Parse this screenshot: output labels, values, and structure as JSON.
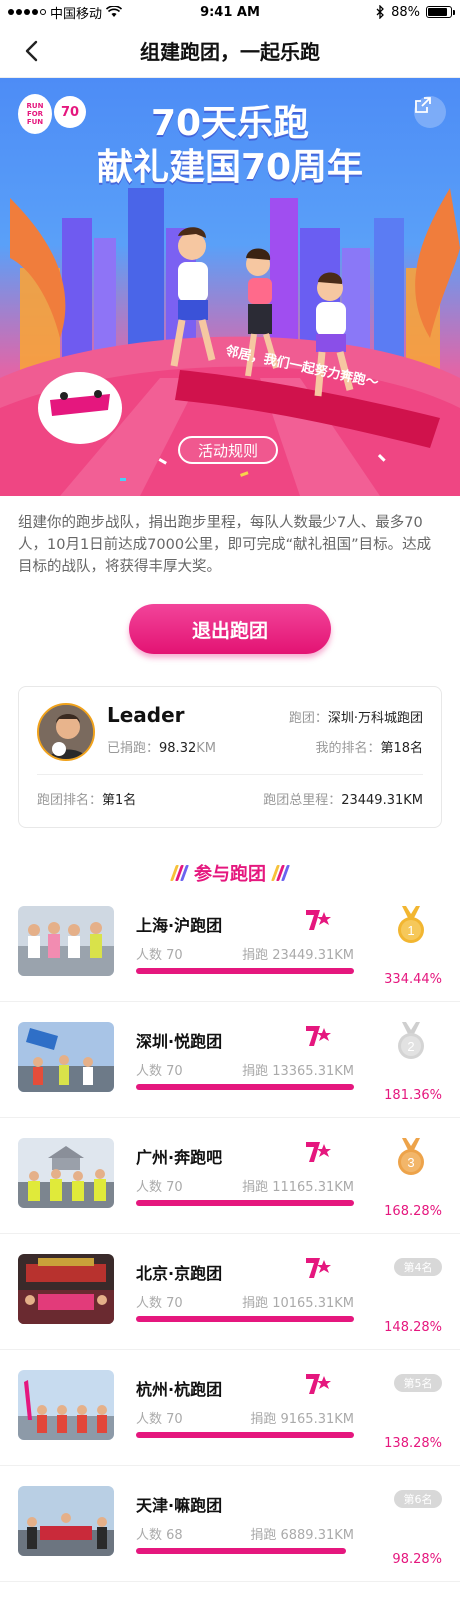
{
  "status_bar": {
    "carrier": "中国移动",
    "time": "9:41 AM",
    "battery": "88%"
  },
  "nav": {
    "title": "组建跑团，一起乐跑"
  },
  "banner": {
    "logo_run": [
      "RUN",
      "FOR",
      "FUN"
    ],
    "logo_70": "70",
    "title_line1": "70天乐跑",
    "title_line2": "献礼建国70周年",
    "ribbon": "邻居，我们一起努力奔跑～",
    "rules_button": "活动规则"
  },
  "description": "组建你的跑步战队，捐出跑步里程，每队人数最少7人、最多70人，10月1日前达成7000公里，即可完成“献礼祖国”目标。达成目标的战队，将获得丰厚大奖。",
  "quit_button": "退出跑团",
  "leader_card": {
    "name": "Leader",
    "team_label": "跑团：",
    "team_value": "深圳·万科城跑团",
    "donated_label": "已捐跑：",
    "donated_value": "98.32",
    "donated_unit": "KM",
    "my_rank_label": "我的排名：",
    "my_rank_value": "第18名",
    "team_rank_label": "跑团排名：",
    "team_rank_value": "第1名",
    "team_total_label": "跑团总里程：",
    "team_total_value": "23449.31KM"
  },
  "section_title": "参与跑团",
  "teams": [
    {
      "name": "上海·沪跑团",
      "members": "人数 70",
      "donated": "捐跑 23449.31KM",
      "percent": "334.44%",
      "rank": "1",
      "medal": "gold"
    },
    {
      "name": "深圳·悦跑团",
      "members": "人数 70",
      "donated": "捐跑 13365.31KM",
      "percent": "181.36%",
      "rank": "2",
      "medal": "silver"
    },
    {
      "name": "广州·奔跑吧",
      "members": "人数 70",
      "donated": "捐跑 11165.31KM",
      "percent": "168.28%",
      "rank": "3",
      "medal": "bronze"
    },
    {
      "name": "北京·京跑团",
      "members": "人数 70",
      "donated": "捐跑 10165.31KM",
      "percent": "148.28%",
      "rank": "第4名",
      "medal": "none"
    },
    {
      "name": "杭州·杭跑团",
      "members": "人数 70",
      "donated": "捐跑 9165.31KM",
      "percent": "138.28%",
      "rank": "第5名",
      "medal": "none"
    },
    {
      "name": "天津·嘛跑团",
      "members": "人数 68",
      "donated": "捐跑 6889.31KM",
      "percent": "98.28%",
      "rank": "第6名",
      "medal": "none"
    }
  ],
  "colors": {
    "accent": "#e5177e",
    "gold": "#f2b631",
    "silver": "#d4d4d4",
    "bronze": "#eda34a"
  }
}
